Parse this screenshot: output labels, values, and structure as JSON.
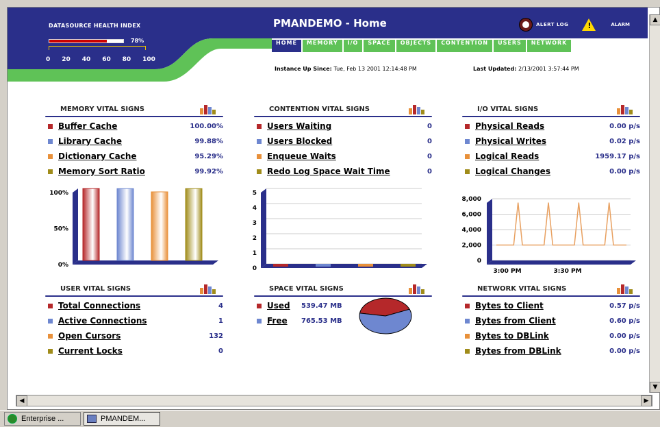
{
  "header": {
    "health_index_title": "DATASOURCE HEALTH INDEX",
    "health_index_value": "78%",
    "health_index_fraction": 0.78,
    "health_scale": [
      "0",
      "20",
      "40",
      "60",
      "80",
      "100"
    ],
    "title": "PMANDEMO - Home",
    "alert_log_label": "ALERT LOG",
    "alarm_label": "ALARM",
    "tabs": [
      {
        "label": "HOME",
        "active": true
      },
      {
        "label": "MEMORY",
        "active": false
      },
      {
        "label": "I/O",
        "active": false
      },
      {
        "label": "SPACE",
        "active": false
      },
      {
        "label": "OBJECTS",
        "active": false
      },
      {
        "label": "CONTENTION",
        "active": false
      },
      {
        "label": "USERS",
        "active": false
      },
      {
        "label": "NETWORK",
        "active": false
      }
    ],
    "instance_label": "Instance Up Since:",
    "instance_value": "Tue, Feb 13 2001 12:14:48 PM",
    "updated_label": "Last Updated:",
    "updated_value": "2/13/2001 3:57:44 PM"
  },
  "colors": {
    "red": "#b5282a",
    "blue": "#6e87d0",
    "orange": "#e8903a",
    "olive": "#a08c1a",
    "navy": "#2a2f8a",
    "green": "#5fc257"
  },
  "memory": {
    "title": "MEMORY VITAL SIGNS",
    "items": [
      {
        "label": "Buffer Cache",
        "value": "100.00%"
      },
      {
        "label": "Library Cache",
        "value": "99.88%"
      },
      {
        "label": "Dictionary Cache",
        "value": "95.29%"
      },
      {
        "label": "Memory Sort Ratio",
        "value": "99.92%"
      }
    ],
    "chart_ticks": [
      "100%",
      "50%",
      "0%"
    ]
  },
  "contention": {
    "title": "CONTENTION VITAL SIGNS",
    "items": [
      {
        "label": "Users Waiting",
        "value": "0"
      },
      {
        "label": "Users Blocked",
        "value": "0"
      },
      {
        "label": "Enqueue Waits",
        "value": "0"
      },
      {
        "label": "Redo Log Space Wait Time",
        "value": "0"
      }
    ],
    "chart_ticks": [
      "5",
      "4",
      "3",
      "2",
      "1",
      "0"
    ]
  },
  "io": {
    "title": "I/O VITAL SIGNS",
    "items": [
      {
        "label": "Physical Reads",
        "value": "0.00 p/s"
      },
      {
        "label": "Physical Writes",
        "value": "0.02 p/s"
      },
      {
        "label": "Logical Reads",
        "value": "1959.17 p/s"
      },
      {
        "label": "Logical Changes",
        "value": "0.00 p/s"
      }
    ],
    "chart_y_ticks": [
      "8,000",
      "6,000",
      "4,000",
      "2,000",
      "0"
    ],
    "chart_x_ticks": [
      "3:00 PM",
      "3:30 PM"
    ]
  },
  "user": {
    "title": "USER VITAL SIGNS",
    "items": [
      {
        "label": "Total Connections",
        "value": "4"
      },
      {
        "label": "Active Connections",
        "value": "1"
      },
      {
        "label": "Open Cursors",
        "value": "132"
      },
      {
        "label": "Current Locks",
        "value": "0"
      }
    ]
  },
  "space": {
    "title": "SPACE VITAL SIGNS",
    "items": [
      {
        "label": "Used",
        "value": "539.47 MB"
      },
      {
        "label": "Free",
        "value": "765.53 MB"
      }
    ]
  },
  "network": {
    "title": "NETWORK VITAL SIGNS",
    "items": [
      {
        "label": "Bytes to Client",
        "value": "0.57 p/s"
      },
      {
        "label": "Bytes from Client",
        "value": "0.60 p/s"
      },
      {
        "label": "Bytes to DBLink",
        "value": "0.00 p/s"
      },
      {
        "label": "Bytes from DBLink",
        "value": "0.00 p/s"
      }
    ]
  },
  "chart_data": [
    {
      "type": "bar",
      "categories": [
        "Buffer Cache",
        "Library Cache",
        "Dictionary Cache",
        "Memory Sort Ratio"
      ],
      "values": [
        100.0,
        99.88,
        95.29,
        99.92
      ],
      "ylim": [
        0,
        100
      ],
      "ytick_labels": [
        "100%",
        "50%",
        "0%"
      ]
    },
    {
      "type": "bar",
      "categories": [
        "Users Waiting",
        "Users Blocked",
        "Enqueue Waits",
        "Redo Log Space Wait Time"
      ],
      "values": [
        0,
        0,
        0,
        0
      ],
      "ylim": [
        0,
        5
      ],
      "ytick_labels": [
        "5",
        "4",
        "3",
        "2",
        "1",
        "0"
      ]
    },
    {
      "type": "line",
      "x_ticks": [
        "3:00 PM",
        "3:30 PM"
      ],
      "ylim": [
        0,
        8000
      ],
      "ytick_labels": [
        "8,000",
        "6,000",
        "4,000",
        "2,000",
        "0"
      ],
      "series": [
        {
          "values": [
            2000,
            2000,
            2000,
            2000,
            2000,
            7500,
            2000,
            2000,
            2000,
            2000,
            2000,
            2000,
            7500,
            2000,
            2000,
            2000,
            2000,
            2000,
            2000,
            7500,
            2000,
            2000,
            2000,
            2000,
            2000,
            2000,
            7500,
            2000,
            2000,
            2000,
            2000
          ]
        }
      ]
    },
    {
      "type": "pie",
      "labels": [
        "Used",
        "Free"
      ],
      "values": [
        539.47,
        765.53
      ]
    }
  ],
  "taskbar": [
    {
      "label": "Enterprise ...",
      "active": false
    },
    {
      "label": "PMANDEM...",
      "active": true
    }
  ]
}
